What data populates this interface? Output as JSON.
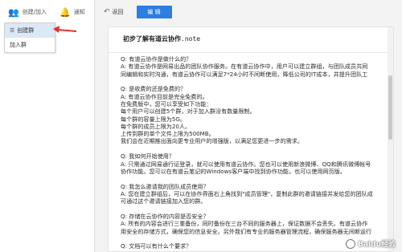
{
  "sidebar": {
    "create_join_label": "创建/加入",
    "notify_label": "通知",
    "menu": [
      {
        "label": "创建群",
        "active": true
      },
      {
        "label": "加入群",
        "active": false
      }
    ]
  },
  "toolbar": {
    "back_label": "返回",
    "edit_label": "编 辑"
  },
  "doc": {
    "title_cn": "初步了解有道云协作",
    "title_ext": ".note",
    "paragraphs": [
      [
        "Q: 有道云协作是做什么的？",
        "A: 有道云协作是网易出品的团队协作服务。在有道云协作中，用户可以建立群组，与团队成员共同",
        "同编辑和实时沟通，有道云协作可以满足7*24小时不间断使用，降低公司的IT成本，并提升团队工"
      ],
      [
        "Q: 是收费的还是免费的？",
        "A: 有道云协作目前是完全免费的。",
        "   在免费版中，您可以享受如下功能：",
        "每个用户可以创建5个群，对于加入群没有数量限制。",
        "每个群的容量上限为5G。",
        "每个群的成员上限为20人。",
        "上传到群的单个文件上限为500MB。",
        "   我们会在近期推出面向更专业用户的增强版，以满足您更进一步的需求。"
      ],
      [
        "Q: 我如何开始使用？",
        "A: 只需通过网易通行证登录，就可以使用有道云协作。您也可以使用新浪微博、QQ和腾讯微博帐号",
        "协作功能。您可以在有道云笔记的Windows客户端中找到协作功能，也可以使用网页版。"
      ],
      [
        "Q: 我怎么邀请我的团队成员使用？",
        "A: 您在建立群组后，可以在协作界面右上角找到\"成员管理\"，复制此群的邀请链接并发给您的团队成",
        "可通过这个邀请链接加入您的群。"
      ],
      [
        "Q: 存储在云协作的内容是否安全？",
        "A: 所有的内容会进行三重备份，同时备份在三台不同的服务器上，保证数据不会丢失。有道云协作",
        "用安全的存储方式，确保您的信息安全。另外我们有专业的服务器管理流程，确保服务器无间断运行"
      ],
      [
        "Q: 文档可以有什么个要求？"
      ]
    ]
  },
  "watermark": "Baidu经验",
  "colors": {
    "accent": "#2d7ee0",
    "arrow": "#e0322d",
    "menu_active": "#dbe8f7"
  }
}
